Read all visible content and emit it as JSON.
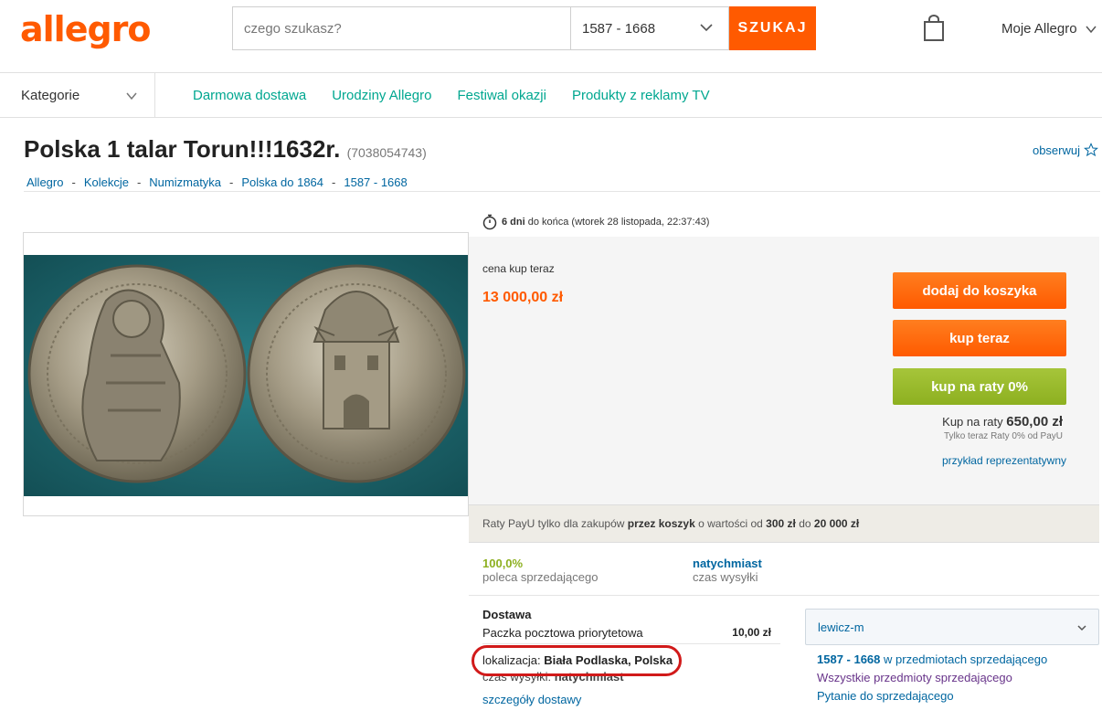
{
  "header": {
    "logo": "allegro",
    "search_placeholder": "czego szukasz?",
    "category_select": "1587 - 1668",
    "search_button": "SZUKAJ",
    "account": "Moje Allegro"
  },
  "nav": {
    "categories": "Kategorie",
    "links": [
      "Darmowa dostawa",
      "Urodziny Allegro",
      "Festiwal okazji",
      "Produkty z reklamy TV"
    ]
  },
  "offer": {
    "title": "Polska 1 talar Torun!!!1632r.",
    "id": "(7038054743)",
    "watch": "obserwuj",
    "breadcrumb": [
      "Allegro",
      "Kolekcje",
      "Numizmatyka",
      "Polska do 1864",
      "1587 - 1668"
    ]
  },
  "timer": {
    "days": "6 dni",
    "rest": " do końca (wtorek 28 listopada, 22:37:43)"
  },
  "purchase": {
    "price_label": "cena kup teraz",
    "price": "13 000,00 zł",
    "add_to_cart": "dodaj do koszyka",
    "buy_now": "kup teraz",
    "installments_btn": "kup na raty 0%",
    "installments_label": "Kup na raty",
    "installments_amount": "650,00 zł",
    "installments_note": "Tylko teraz Raty 0% od PayU",
    "example_link": "przykład reprezentatywny"
  },
  "payu": {
    "t1": "Raty PayU tylko dla zakupów ",
    "b1": "przez koszyk",
    "t2": " o wartości od ",
    "b2": "300 zł",
    "t3": " do ",
    "b3": "20 000 zł"
  },
  "stats": {
    "recommend_value": "100,0%",
    "recommend_label": "poleca sprzedającego",
    "shipping_value": "natychmiast",
    "shipping_label": "czas wysyłki"
  },
  "delivery": {
    "title": "Dostawa",
    "method": "Paczka pocztowa priorytetowa",
    "cost": "10,00 zł",
    "location_label": "lokalizacja: ",
    "location": "Biała Podlaska, Polska",
    "dispatch_label": "czas wysyłki: ",
    "dispatch": "natychmiast",
    "details": "szczegóły dostawy"
  },
  "seller": {
    "name": "lewicz-m",
    "cat_link": "1587 - 1668",
    "cat_rest": " w przedmiotach sprzedającego",
    "all_items": "Wszystkie przedmioty sprzedającego",
    "ask": "Pytanie do sprzedającego"
  }
}
